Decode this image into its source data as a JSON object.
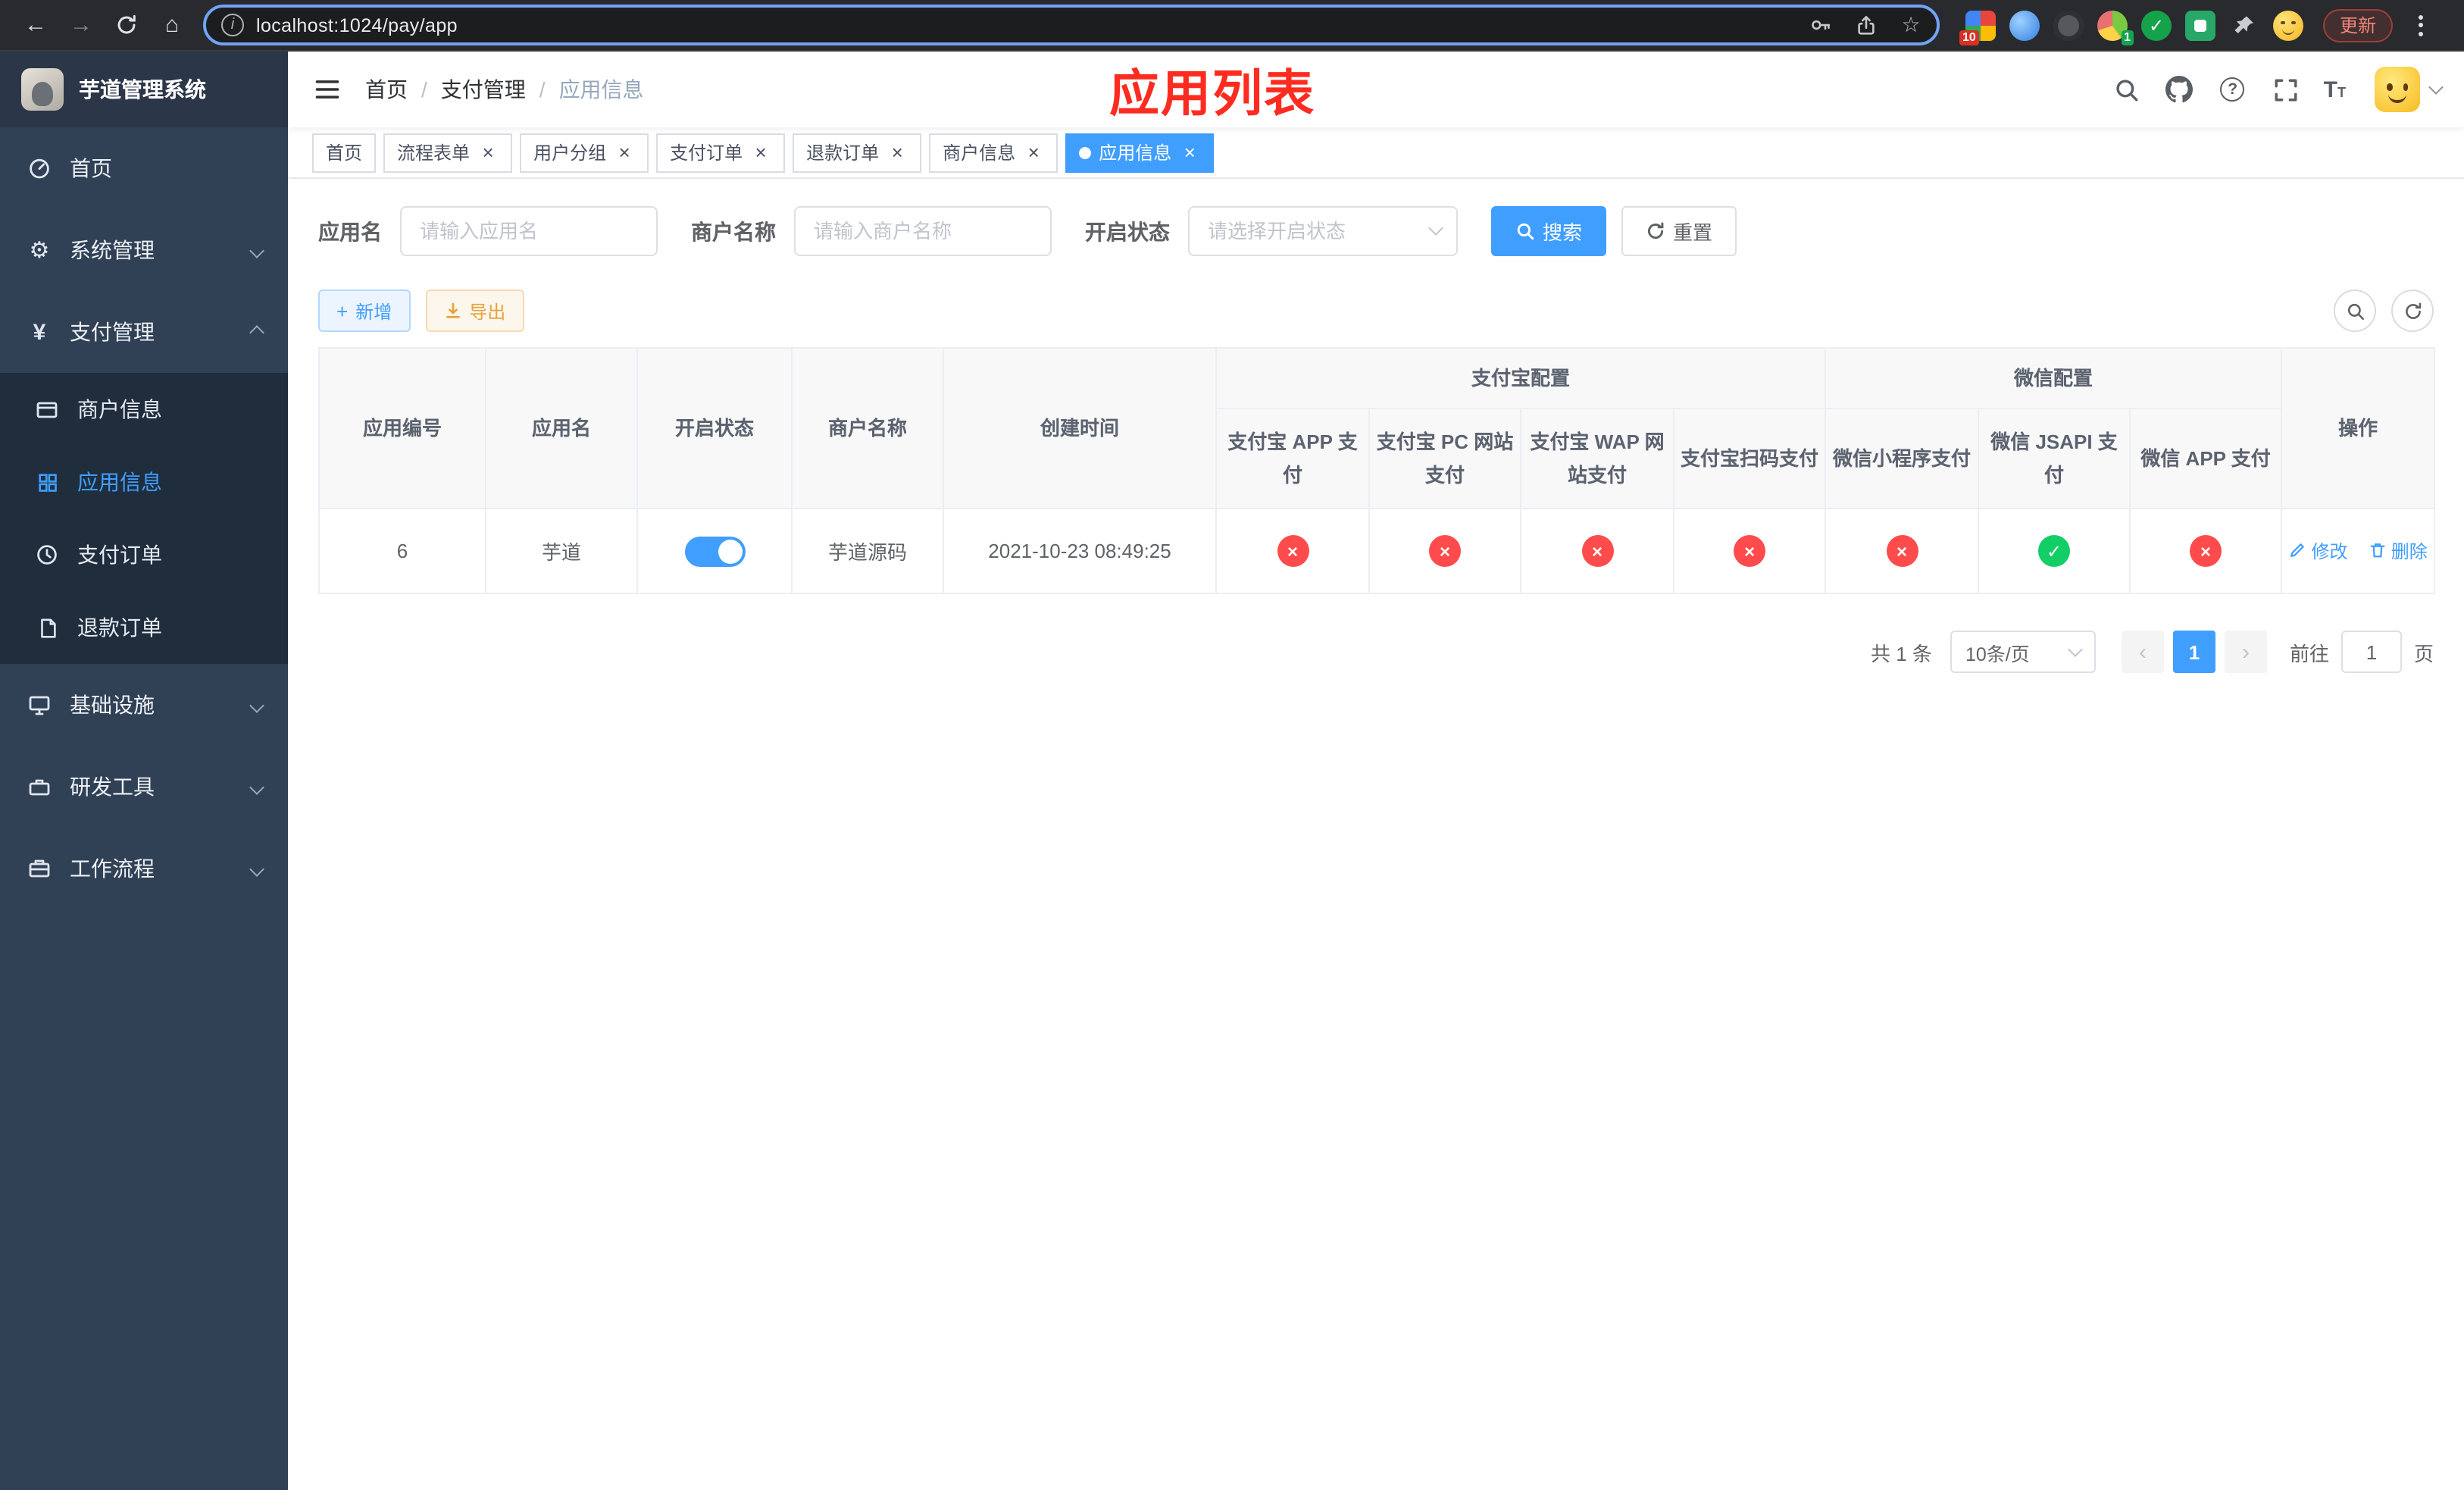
{
  "browser": {
    "url": "localhost:1024/pay/app",
    "update_label": "更新",
    "extension_badge_1": "10",
    "extension_badge_2": "1"
  },
  "icons": {
    "back": "←",
    "forward": "→",
    "home": "⌂",
    "info": "i",
    "star": "☆",
    "gear": "⚙",
    "yen": "¥",
    "plus": "+",
    "close": "×",
    "check": "✓",
    "cross": "×",
    "prev": "‹",
    "next": "›",
    "question": "?",
    "size_large": "T",
    "size_small": "T"
  },
  "sidebar": {
    "logo_title": "芋道管理系统",
    "items": [
      {
        "label": "首页"
      },
      {
        "label": "系统管理"
      },
      {
        "label": "支付管理"
      },
      {
        "label": "基础设施"
      },
      {
        "label": "研发工具"
      },
      {
        "label": "工作流程"
      }
    ],
    "payment_submenu": [
      {
        "label": "商户信息"
      },
      {
        "label": "应用信息",
        "active": true
      },
      {
        "label": "支付订单"
      },
      {
        "label": "退款订单"
      }
    ]
  },
  "header": {
    "breadcrumb": [
      "首页",
      "支付管理",
      "应用信息"
    ],
    "page_annotation": "应用列表"
  },
  "tabs": [
    {
      "label": "首页",
      "closable": false,
      "active": false
    },
    {
      "label": "流程表单",
      "closable": true,
      "active": false
    },
    {
      "label": "用户分组",
      "closable": true,
      "active": false
    },
    {
      "label": "支付订单",
      "closable": true,
      "active": false
    },
    {
      "label": "退款订单",
      "closable": true,
      "active": false
    },
    {
      "label": "商户信息",
      "closable": true,
      "active": false
    },
    {
      "label": "应用信息",
      "closable": true,
      "active": true
    }
  ],
  "filters": {
    "app_name_label": "应用名",
    "app_name_placeholder": "请输入应用名",
    "merchant_label": "商户名称",
    "merchant_placeholder": "请输入商户名称",
    "status_label": "开启状态",
    "status_placeholder": "请选择开启状态",
    "search_label": "搜索",
    "reset_label": "重置"
  },
  "toolbar": {
    "add_label": "新增",
    "export_label": "导出"
  },
  "table": {
    "group_alipay": "支付宝配置",
    "group_wechat": "微信配置",
    "headers_simple": [
      "应用编号",
      "应用名",
      "开启状态",
      "商户名称",
      "创建时间"
    ],
    "headers_alipay": [
      "支付宝 APP 支付",
      "支付宝 PC 网站支付",
      "支付宝 WAP 网站支付",
      "支付宝扫码支付"
    ],
    "headers_wechat": [
      "微信小程序支付",
      "微信 JSAPI 支付",
      "微信 APP 支付"
    ],
    "header_action": "操作",
    "rows": [
      {
        "app_id": "6",
        "app_name": "芋道",
        "status_enabled": true,
        "merchant_name": "芋道源码",
        "created_at": "2021-10-23 08:49:25",
        "pay_configs": [
          false,
          false,
          false,
          false,
          false,
          true,
          false
        ],
        "edit_label": "修改",
        "delete_label": "删除"
      }
    ]
  },
  "pagination": {
    "total_text": "共 1 条",
    "page_size_text": "10条/页",
    "current_page": "1",
    "goto_prefix": "前往",
    "goto_value": "1",
    "goto_suffix": "页"
  },
  "colors": {
    "accent": "#409EFF",
    "success": "#13ce66",
    "danger": "#ff4b4b",
    "warning": "#e6a23c",
    "annotation_red": "#fe2c20",
    "sidebar_bg": "#304156",
    "submenu_bg": "#1f2d3d"
  }
}
